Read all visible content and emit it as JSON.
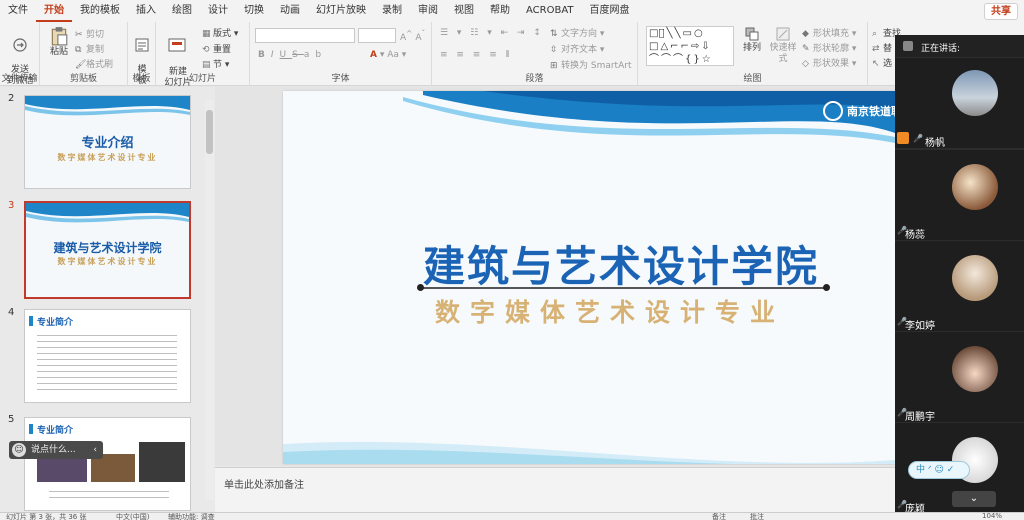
{
  "tabs": [
    "文件",
    "开始",
    "我的模板",
    "插入",
    "绘图",
    "设计",
    "切换",
    "动画",
    "幻灯片放映",
    "录制",
    "审阅",
    "视图",
    "帮助",
    "ACROBAT",
    "百度网盘"
  ],
  "active_tab": "开始",
  "share_label": "共享",
  "ribbon": {
    "file_transfer": {
      "send_label": "发送\n到微信",
      "group": "文件传输"
    },
    "clipboard": {
      "paste": "粘贴",
      "cut": "剪切",
      "copy": "复制",
      "format_painter": "格式刷",
      "group": "剪贴板"
    },
    "templates": {
      "template": "模\n板",
      "group": "模板"
    },
    "slides": {
      "new_slide": "新建\n幻灯片",
      "layout": "版式",
      "reset": "重置",
      "section": "节",
      "group": "幻灯片"
    },
    "font": {
      "group": "字体",
      "bold": "B",
      "italic": "I",
      "underline": "U",
      "strike": "S",
      "shadow": "ab"
    },
    "paragraph": {
      "text_direction": "文字方向",
      "align_text": "对齐文本",
      "smartart": "转换为 SmartArt",
      "group": "段落"
    },
    "drawing": {
      "arrange": "排列",
      "quick_styles": "快速样式",
      "fill": "形状填充",
      "outline": "形状轮廓",
      "effects": "形状效果",
      "group": "绘图"
    },
    "editing": {
      "find": "查找",
      "replace": "替",
      "select": "选"
    }
  },
  "thumbnails": [
    {
      "num": "2",
      "title": "专业介绍",
      "sub": "数字媒体艺术设计专业"
    },
    {
      "num": "3",
      "title": "建筑与艺术设计学院",
      "sub": "数字媒体艺术设计专业"
    },
    {
      "num": "4",
      "title": "专业简介"
    },
    {
      "num": "5",
      "title": "专业简介"
    }
  ],
  "slide": {
    "title": "建筑与艺术设计学院",
    "subtitle": "数字媒体艺术设计专业",
    "logo": "南京铁道职业"
  },
  "notes_placeholder": "单击此处添加备注",
  "status": {
    "slide_info": "幻灯片 第 3 张，共 36 张",
    "language": "中文(中国)",
    "accessibility": "辅助功能: 调查",
    "notes": "备注",
    "comments": "批注",
    "zoom": "104%"
  },
  "meeting": {
    "speaking_label": "正在讲话:",
    "participants": [
      "杨帆",
      "杨蕊",
      "李如婷",
      "周鹏宇",
      "庞颖"
    ]
  },
  "chat_popup": "说点什么...",
  "ime_label": "中"
}
